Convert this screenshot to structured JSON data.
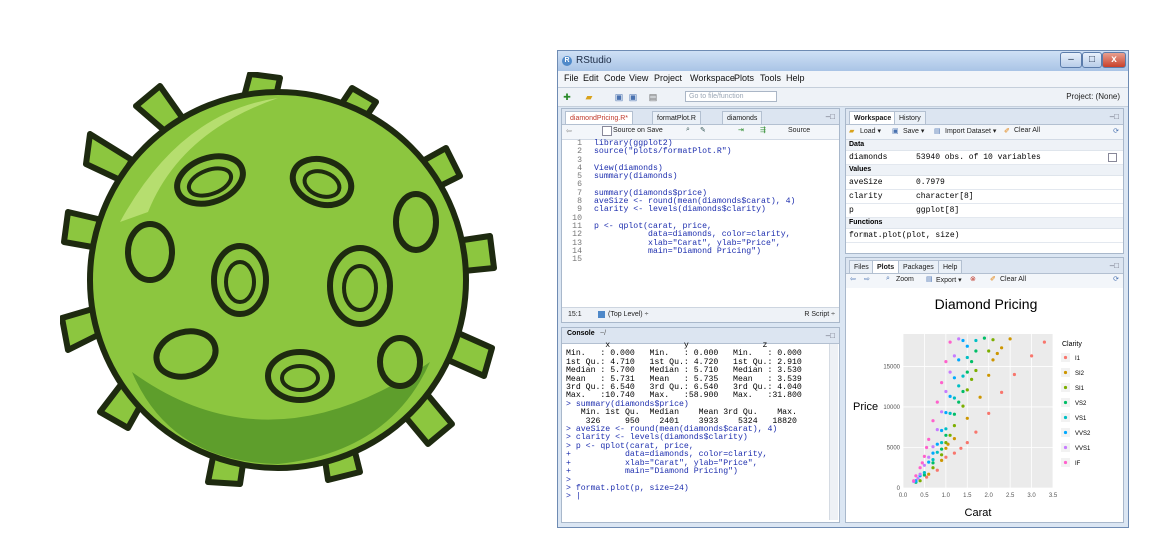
{
  "virus": {
    "body_color": "#8cc63f",
    "dark_color": "#5e9e2c",
    "outline_color": "#1e2a10"
  },
  "window": {
    "title": "RStudio",
    "controls": [
      "–",
      "□",
      "x"
    ],
    "project": "Project: (None)",
    "goto_file": "Go to file/function"
  },
  "menu": [
    "File",
    "Edit",
    "Code",
    "View",
    "Project",
    "Workspace",
    "Plots",
    "Tools",
    "Help"
  ],
  "editor": {
    "tabs": [
      "diamondPricing.R*",
      "formatPlot.R",
      "diamonds"
    ],
    "source_on_save": "Source on Save",
    "source_button": "Source",
    "line_numbers": [
      "1",
      "2",
      "3",
      "4",
      "5",
      "6",
      "7",
      "8",
      "9",
      "10",
      "11",
      "12",
      "13",
      "14",
      "15"
    ],
    "lines": [
      "library(ggplot2)",
      "source(\"plots/formatPlot.R\")",
      "",
      "View(diamonds)",
      "summary(diamonds)",
      "",
      "summary(diamonds$price)",
      "aveSize <- round(mean(diamonds$carat), 4)",
      "clarity <- levels(diamonds$clarity)",
      "",
      "p <- qplot(carat, price,",
      "           data=diamonds, color=clarity,",
      "           xlab=\"Carat\", ylab=\"Price\",",
      "           main=\"Diamond Pricing\")",
      ""
    ],
    "status_pos": "15:1",
    "status_scope": "(Top Level) ÷",
    "status_type": "R Script ÷"
  },
  "console": {
    "title": "Console",
    "path": "~/",
    "lines": [
      {
        "t": "out",
        "s": "        x               y               z         "
      },
      {
        "t": "out",
        "s": "Min.   : 0.000   Min.   : 0.000   Min.   : 0.000  "
      },
      {
        "t": "out",
        "s": "1st Qu.: 4.710   1st Qu.: 4.720   1st Qu.: 2.910  "
      },
      {
        "t": "out",
        "s": "Median : 5.700   Median : 5.710   Median : 3.530  "
      },
      {
        "t": "out",
        "s": "Mean   : 5.731   Mean   : 5.735   Mean   : 3.539  "
      },
      {
        "t": "out",
        "s": "3rd Qu.: 6.540   3rd Qu.: 6.540   3rd Qu.: 4.040  "
      },
      {
        "t": "out",
        "s": "Max.   :10.740   Max.   :58.900   Max.   :31.800  "
      },
      {
        "t": "inp",
        "s": "> summary(diamonds$price)"
      },
      {
        "t": "out",
        "s": "   Min. 1st Qu.  Median    Mean 3rd Qu.    Max. "
      },
      {
        "t": "out",
        "s": "    326     950    2401    3933    5324   18820 "
      },
      {
        "t": "inp",
        "s": "> aveSize <- round(mean(diamonds$carat), 4)"
      },
      {
        "t": "inp",
        "s": "> clarity <- levels(diamonds$clarity)"
      },
      {
        "t": "inp",
        "s": "> p <- qplot(carat, price,"
      },
      {
        "t": "inp",
        "s": "+           data=diamonds, color=clarity,"
      },
      {
        "t": "inp",
        "s": "+           xlab=\"Carat\", ylab=\"Price\","
      },
      {
        "t": "inp",
        "s": "+           main=\"Diamond Pricing\")"
      },
      {
        "t": "inp",
        "s": ">"
      },
      {
        "t": "inp",
        "s": "> format.plot(p, size=24)"
      },
      {
        "t": "inp",
        "s": "> |"
      }
    ]
  },
  "workspace": {
    "tabs": [
      "Workspace",
      "History"
    ],
    "toolbar": [
      "Load ▾",
      "Save ▾",
      "Import Dataset ▾",
      "Clear All"
    ],
    "data_header": "Data",
    "data": [
      {
        "name": "diamonds",
        "value": "53940 obs. of 10 variables"
      }
    ],
    "values_header": "Values",
    "values": [
      {
        "name": "aveSize",
        "value": "0.7979"
      },
      {
        "name": "clarity",
        "value": "character[8]"
      },
      {
        "name": "p",
        "value": "ggplot[8]"
      }
    ],
    "functions_header": "Functions",
    "functions": [
      "format.plot(plot, size)"
    ]
  },
  "plots_pane": {
    "tabs": [
      "Files",
      "Plots",
      "Packages",
      "Help"
    ],
    "toolbar": [
      "Zoom",
      "Export ▾",
      "Clear All"
    ]
  },
  "chart_data": {
    "type": "scatter",
    "title": "Diamond Pricing",
    "xlabel": "Carat",
    "ylabel": "Price",
    "xlim": [
      0,
      3.5
    ],
    "ylim": [
      0,
      19000
    ],
    "xticks": [
      "0.0",
      "0.5",
      "1.0",
      "1.5",
      "2.0",
      "2.5",
      "3.0",
      "3.5"
    ],
    "yticks": [
      {
        "v": 0,
        "label": "0"
      },
      {
        "v": 5000,
        "label": "5000"
      },
      {
        "v": 10000,
        "label": "10000"
      },
      {
        "v": 15000,
        "label": "15000"
      }
    ],
    "legend_title": "Clarity",
    "legend_position": "right",
    "grid": true,
    "series": [
      {
        "name": "I1",
        "color": "#f8766d",
        "values": [
          [
            0.8,
            2200
          ],
          [
            1.0,
            3800
          ],
          [
            1.2,
            4300
          ],
          [
            1.5,
            5600
          ],
          [
            1.7,
            6900
          ],
          [
            2.0,
            9200
          ],
          [
            2.3,
            11800
          ],
          [
            2.6,
            14000
          ],
          [
            3.0,
            16300
          ],
          [
            3.3,
            18000
          ],
          [
            0.55,
            1350
          ],
          [
            1.35,
            4900
          ]
        ]
      },
      {
        "name": "SI2",
        "color": "#cd9600",
        "values": [
          [
            0.6,
            1700
          ],
          [
            0.9,
            3400
          ],
          [
            1.0,
            4900
          ],
          [
            1.2,
            6100
          ],
          [
            1.5,
            8600
          ],
          [
            1.8,
            11200
          ],
          [
            2.0,
            13900
          ],
          [
            2.1,
            15800
          ],
          [
            2.3,
            17300
          ],
          [
            2.5,
            18400
          ],
          [
            1.05,
            5400
          ],
          [
            2.2,
            16600
          ]
        ]
      },
      {
        "name": "SI1",
        "color": "#7cae00",
        "values": [
          [
            0.4,
            900
          ],
          [
            0.7,
            2500
          ],
          [
            0.9,
            4100
          ],
          [
            1.0,
            5600
          ],
          [
            1.2,
            7700
          ],
          [
            1.4,
            10100
          ],
          [
            1.5,
            12100
          ],
          [
            1.7,
            14500
          ],
          [
            2.0,
            16900
          ],
          [
            2.1,
            18300
          ],
          [
            1.1,
            6500
          ],
          [
            1.6,
            13400
          ]
        ]
      },
      {
        "name": "VS2",
        "color": "#00be67",
        "values": [
          [
            0.3,
            700
          ],
          [
            0.5,
            1600
          ],
          [
            0.7,
            3100
          ],
          [
            0.9,
            4800
          ],
          [
            1.0,
            6500
          ],
          [
            1.2,
            9100
          ],
          [
            1.4,
            11900
          ],
          [
            1.5,
            14300
          ],
          [
            1.7,
            16900
          ],
          [
            1.9,
            18500
          ],
          [
            1.3,
            10600
          ],
          [
            1.6,
            15600
          ]
        ]
      },
      {
        "name": "VS1",
        "color": "#00bfc4",
        "values": [
          [
            0.3,
            800
          ],
          [
            0.5,
            1900
          ],
          [
            0.7,
            3500
          ],
          [
            0.9,
            5600
          ],
          [
            1.0,
            7300
          ],
          [
            1.1,
            9200
          ],
          [
            1.2,
            11100
          ],
          [
            1.4,
            13800
          ],
          [
            1.5,
            16100
          ],
          [
            1.7,
            18200
          ],
          [
            0.8,
            4400
          ],
          [
            1.3,
            12600
          ]
        ]
      },
      {
        "name": "VVS2",
        "color": "#00a9ff",
        "values": [
          [
            0.3,
            900
          ],
          [
            0.4,
            1500
          ],
          [
            0.6,
            3200
          ],
          [
            0.8,
            5400
          ],
          [
            0.9,
            7100
          ],
          [
            1.0,
            9300
          ],
          [
            1.1,
            11300
          ],
          [
            1.2,
            13600
          ],
          [
            1.3,
            15800
          ],
          [
            1.4,
            18200
          ],
          [
            0.7,
            4300
          ],
          [
            1.5,
            17500
          ]
        ]
      },
      {
        "name": "VVS1",
        "color": "#c77cff",
        "values": [
          [
            0.25,
            800
          ],
          [
            0.4,
            1700
          ],
          [
            0.5,
            2800
          ],
          [
            0.7,
            5100
          ],
          [
            0.8,
            7200
          ],
          [
            0.9,
            9400
          ],
          [
            1.0,
            11900
          ],
          [
            1.1,
            14300
          ],
          [
            1.2,
            16300
          ],
          [
            1.3,
            18400
          ],
          [
            0.6,
            3800
          ],
          [
            0.35,
            1200
          ]
        ]
      },
      {
        "name": "IF",
        "color": "#ff61cc",
        "values": [
          [
            0.25,
            900
          ],
          [
            0.3,
            1500
          ],
          [
            0.4,
            2500
          ],
          [
            0.5,
            3900
          ],
          [
            0.6,
            6000
          ],
          [
            0.7,
            8300
          ],
          [
            0.8,
            10600
          ],
          [
            0.9,
            13000
          ],
          [
            1.0,
            15600
          ],
          [
            1.1,
            18000
          ],
          [
            0.45,
            3100
          ],
          [
            0.55,
            5000
          ]
        ]
      }
    ]
  }
}
